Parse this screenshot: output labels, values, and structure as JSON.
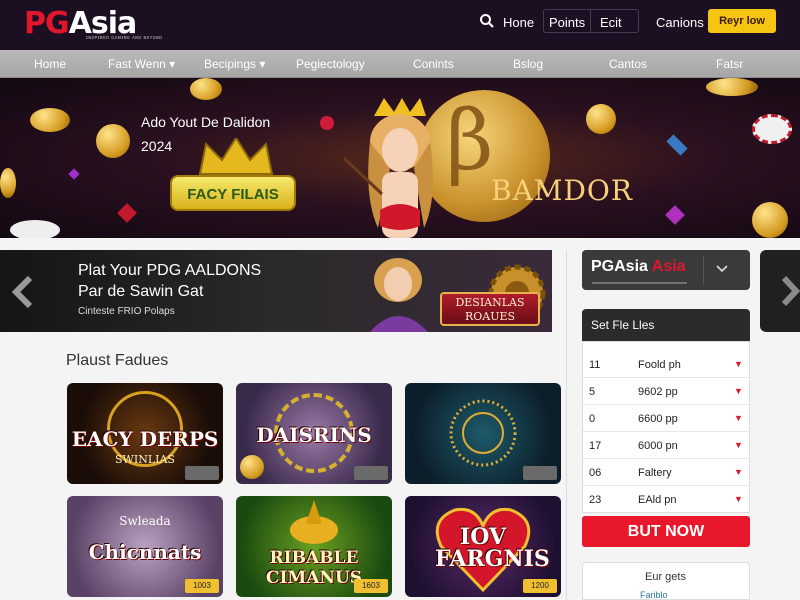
{
  "header": {
    "logo_pg": "PG",
    "logo_asia": "Asia",
    "logo_tagline": "ɪɴsᴘɪʀᴇᴅ ɢᴀᴍɪɴɢ ᴀɴᴅ ʙᴇʏᴏɴᴅ",
    "links": [
      "Hone",
      "Points",
      "Ecit",
      "Canions"
    ],
    "play_button": "Reyr low"
  },
  "nav": {
    "items": [
      "Home",
      "Fast Wenn ▾",
      "Becipings ▾",
      "Pegiectology",
      "Conints",
      "Bslog",
      "Cantos",
      "Fatsr"
    ]
  },
  "hero": {
    "line1": "Ado Yout De Dalidon",
    "line2": "2024",
    "badge": "FACY FILAIS",
    "brand": "BAMDOR"
  },
  "promo": {
    "title1": "Plat Your PDG AALDONS",
    "title2": "Par de Sawin Gat",
    "subtitle": "Cinteste FRIO Polaps",
    "sign_line1": "DESIANLAS",
    "sign_line2": "ROAUES"
  },
  "games": {
    "section_title": "Plaust Fadues",
    "tiles": [
      {
        "name": "EACY DERPS",
        "sub": "SWINLIAS",
        "tag": ""
      },
      {
        "name": "DAISRINS",
        "sub": "",
        "tag": ""
      },
      {
        "name": "",
        "sub": "",
        "tag": ""
      },
      {
        "name": "Chicnnats",
        "sub": "Swleada",
        "tag": "1003"
      },
      {
        "name": "RIBABLE CIMANUS",
        "sub": "",
        "tag": "1603"
      },
      {
        "name": "IOV FARGNIS",
        "sub": "",
        "tag": "1200"
      }
    ]
  },
  "sidebar": {
    "logo_pg": "PG",
    "logo_asia": "Asia",
    "logo_asia_red": "Asia",
    "list_title": "Set Fle Lles",
    "rows": [
      {
        "n": "11",
        "t": "Foold ph"
      },
      {
        "n": "5",
        "t": "9602 pp"
      },
      {
        "n": "0",
        "t": "6600 pp"
      },
      {
        "n": "17",
        "t": "6000 pn"
      },
      {
        "n": "06",
        "t": "Faltery"
      },
      {
        "n": "23",
        "t": "EAld pn"
      }
    ],
    "buy_button": "BUT NOW",
    "widget_title": "Eur gets",
    "widget_sub": "Fariblo"
  },
  "colors": {
    "header_bg": "#1d0f22",
    "brand_red": "#e1162d",
    "cta_yellow": "#f6c513",
    "buy_red": "#e8172b",
    "nav_gray": "#b3b3b3"
  }
}
